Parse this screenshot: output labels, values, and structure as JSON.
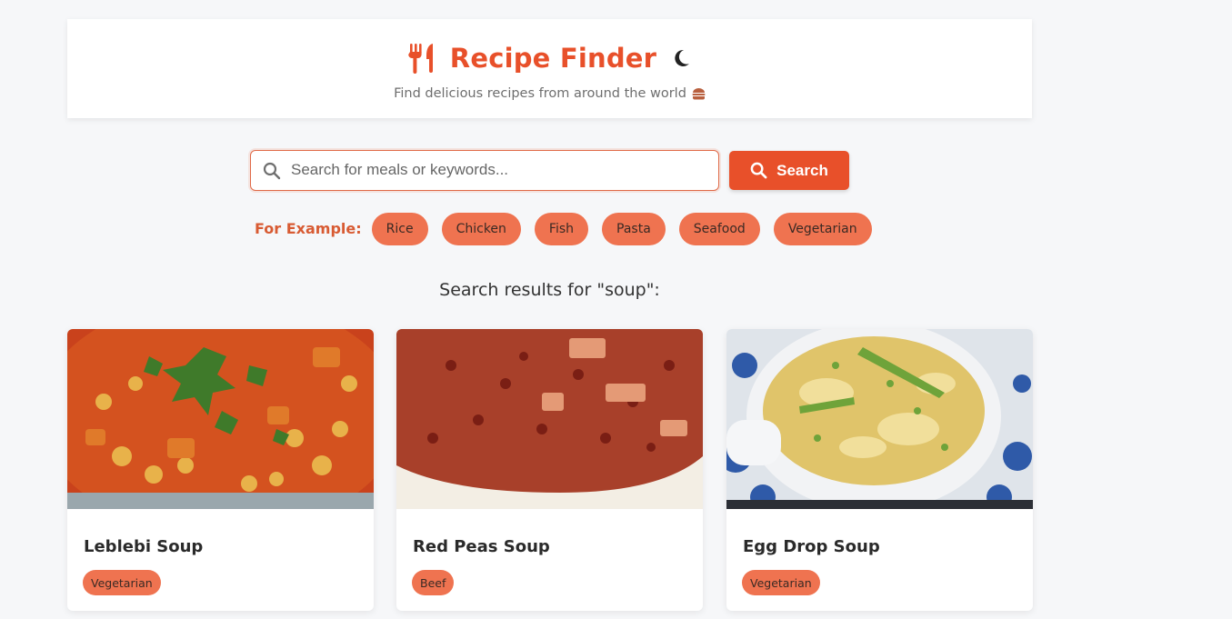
{
  "header": {
    "title": "Recipe Finder",
    "subtitle": "Find delicious recipes from around the world",
    "icons": {
      "logo": "utensils-icon",
      "theme_toggle": "moon-icon",
      "subtitle_icon": "burger-icon"
    }
  },
  "search": {
    "placeholder": "Search for meals or keywords...",
    "value": "",
    "button_label": "Search"
  },
  "examples": {
    "label": "For Example:",
    "chips": [
      "Rice",
      "Chicken",
      "Fish",
      "Pasta",
      "Seafood",
      "Vegetarian"
    ]
  },
  "results": {
    "title": "Search results for \"soup\":",
    "cards": [
      {
        "name": "Leblebi Soup",
        "tag": "Vegetarian"
      },
      {
        "name": "Red Peas Soup",
        "tag": "Beef"
      },
      {
        "name": "Egg Drop Soup",
        "tag": "Vegetarian"
      }
    ]
  },
  "colors": {
    "accent": "#e8502a",
    "chip": "#ef7350",
    "background": "#f6f7f9"
  }
}
